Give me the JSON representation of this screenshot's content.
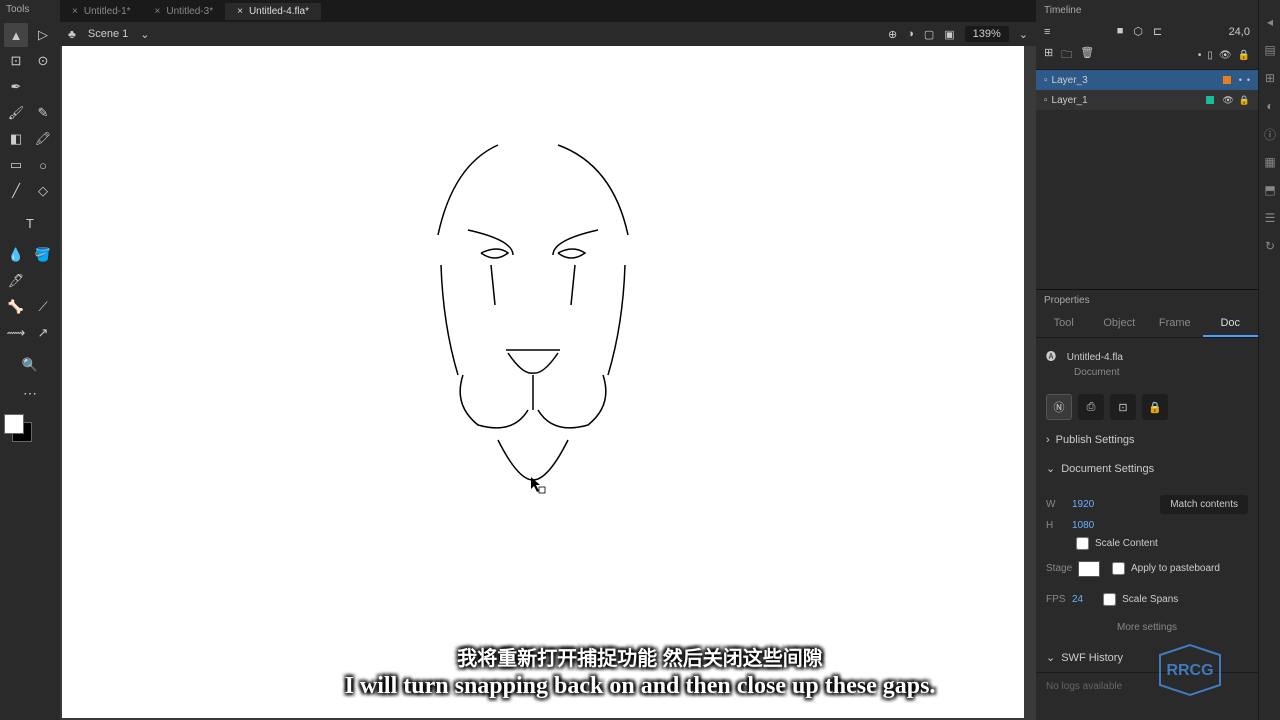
{
  "tabs": [
    {
      "label": "Untitled-1*"
    },
    {
      "label": "Untitled-3*"
    },
    {
      "label": "Untitled-4.fla*"
    }
  ],
  "active_tab_index": 2,
  "scene": {
    "name": "Scene 1",
    "zoom": "139%"
  },
  "tools_title": "Tools",
  "timeline": {
    "title": "Timeline",
    "frame_display": "24,0",
    "layers": [
      {
        "name": "Layer_3",
        "color": "#e67e22",
        "selected": true,
        "hidden": false,
        "locked": false
      },
      {
        "name": "Layer_1",
        "color": "#1abc9c",
        "selected": false,
        "hidden": true,
        "locked": true
      }
    ]
  },
  "properties": {
    "title": "Properties",
    "tabs": [
      "Tool",
      "Object",
      "Frame",
      "Doc"
    ],
    "active_tab": "Doc",
    "doc_name": "Untitled-4.fla",
    "doc_type": "Document",
    "publish_settings": "Publish Settings",
    "document_settings": "Document Settings",
    "width_label": "W",
    "width": "1920",
    "height_label": "H",
    "height": "1080",
    "match_contents": "Match contents",
    "scale_content": "Scale Content",
    "stage_label": "Stage",
    "apply_to_pasteboard": "Apply to pasteboard",
    "fps_label": "FPS",
    "fps": "24",
    "scale_spans": "Scale Spans",
    "more_settings": "More settings",
    "swf_history": "SWF History",
    "no_logs": "No logs available"
  },
  "subtitles": {
    "line1": "我将重新打开捕捉功能 然后关闭这些间隙",
    "line2": "I will turn snapping back on and then close up these gaps."
  },
  "watermark": "RRCG"
}
